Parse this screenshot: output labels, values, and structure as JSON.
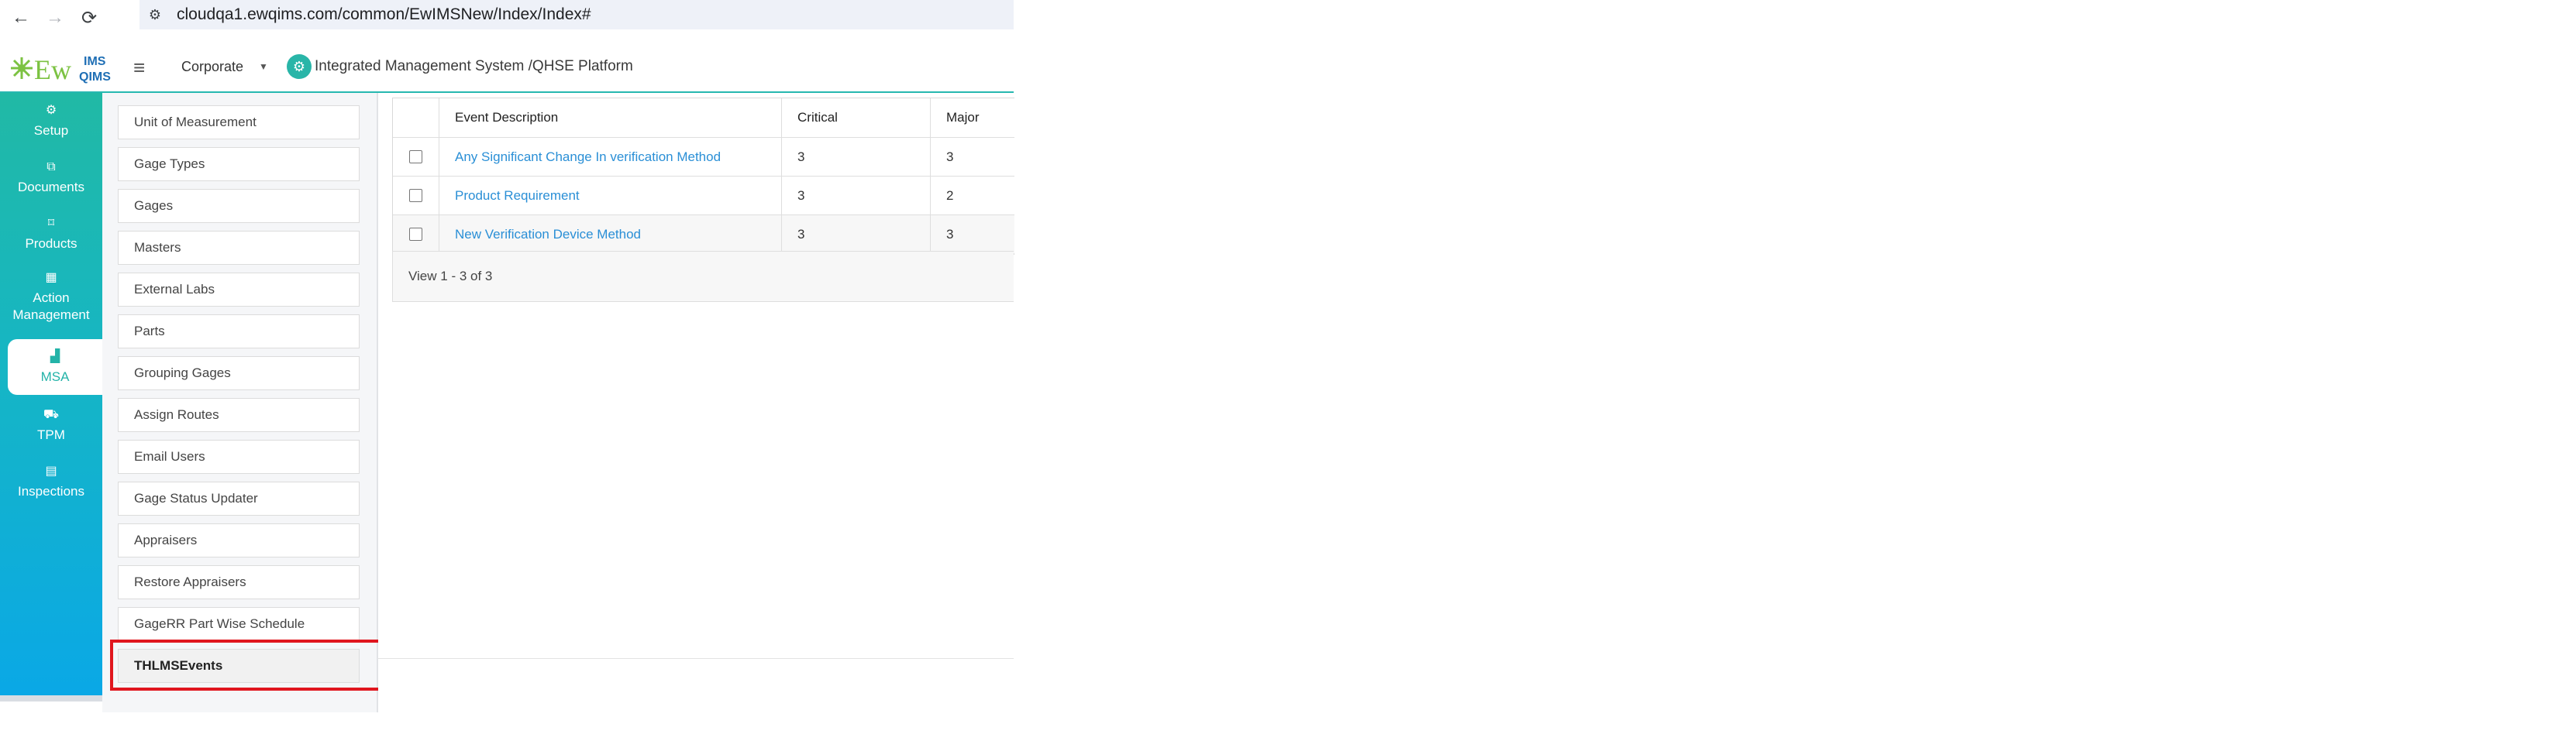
{
  "browser": {
    "url": "cloudqa1.ewqims.com/common/EwIMSNew/Index/Index#"
  },
  "header": {
    "logo_main": "EwQIMS",
    "logo_ims": "IMS",
    "logo_qims": "QIMS",
    "company": "Corporate",
    "platform_title": "Integrated Management System /QHSE Platform"
  },
  "modules": [
    {
      "label": "Setup",
      "icon": "gear-icon"
    },
    {
      "label": "Documents",
      "icon": "documents-icon"
    },
    {
      "label": "Products",
      "icon": "products-icon"
    },
    {
      "label": "Action Management",
      "icon": "action-icon"
    },
    {
      "label": "MSA",
      "icon": "chart-icon"
    },
    {
      "label": "TPM",
      "icon": "tpm-icon"
    },
    {
      "label": "Inspections",
      "icon": "inspections-icon"
    }
  ],
  "submenu": [
    "Unit of Measurement",
    "Gage Types",
    "Gages",
    "Masters",
    "External Labs",
    "Parts",
    "Grouping Gages",
    "Assign Routes",
    "Email Users",
    "Gage Status Updater",
    "Appraisers",
    "Restore Appraisers",
    "GageRR Part Wise Schedule",
    "THLMSEvents"
  ],
  "grid": {
    "columns": [
      "Event Description",
      "Critical",
      "Major"
    ],
    "rows": [
      {
        "description": "Any Significant Change In verification Method",
        "critical": "3",
        "major": "3"
      },
      {
        "description": "Product Requirement",
        "critical": "3",
        "major": "2"
      },
      {
        "description": "New Verification Device Method",
        "critical": "3",
        "major": "3"
      }
    ],
    "pager_text": "View 1 - 3 of 3"
  },
  "colors": {
    "accent": "#27b8b0",
    "link": "#2a8fd6",
    "highlight": "#e0161e"
  }
}
